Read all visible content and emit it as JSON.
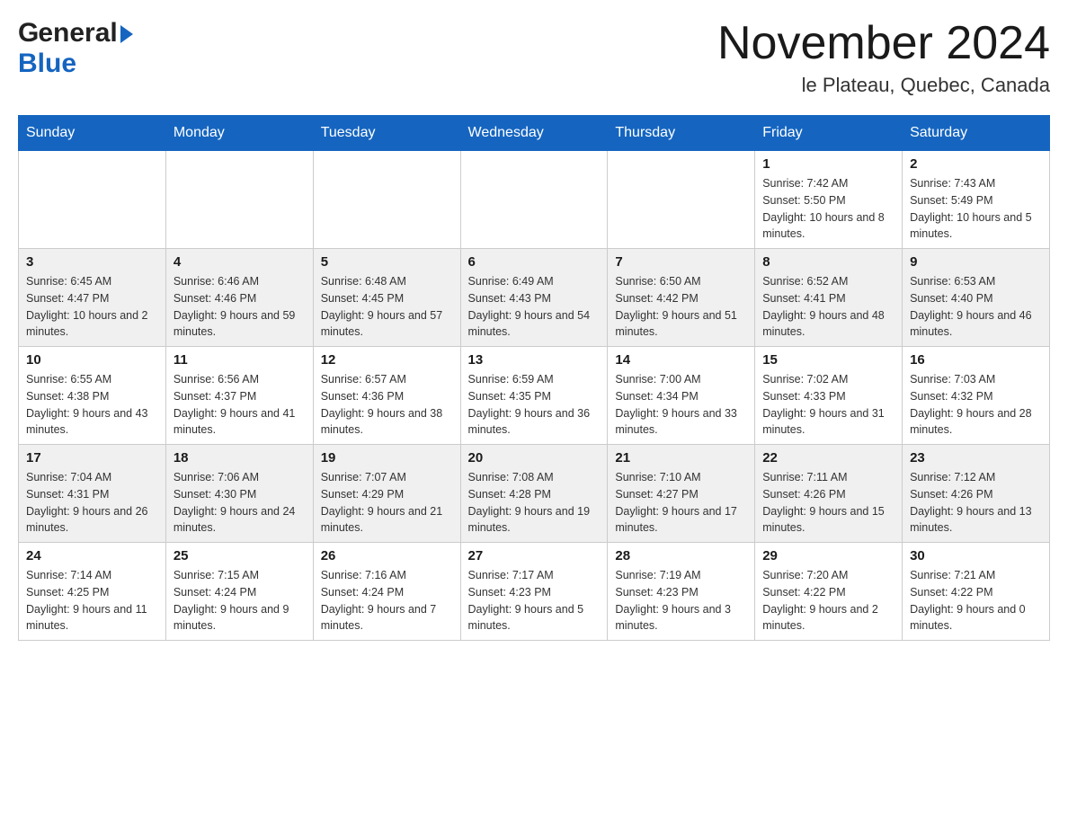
{
  "header": {
    "month_title": "November 2024",
    "location": "le Plateau, Quebec, Canada",
    "logo_general": "General",
    "logo_blue": "Blue"
  },
  "days_of_week": [
    "Sunday",
    "Monday",
    "Tuesday",
    "Wednesday",
    "Thursday",
    "Friday",
    "Saturday"
  ],
  "weeks": [
    [
      {
        "day": "",
        "sunrise": "",
        "sunset": "",
        "daylight": ""
      },
      {
        "day": "",
        "sunrise": "",
        "sunset": "",
        "daylight": ""
      },
      {
        "day": "",
        "sunrise": "",
        "sunset": "",
        "daylight": ""
      },
      {
        "day": "",
        "sunrise": "",
        "sunset": "",
        "daylight": ""
      },
      {
        "day": "",
        "sunrise": "",
        "sunset": "",
        "daylight": ""
      },
      {
        "day": "1",
        "sunrise": "Sunrise: 7:42 AM",
        "sunset": "Sunset: 5:50 PM",
        "daylight": "Daylight: 10 hours and 8 minutes."
      },
      {
        "day": "2",
        "sunrise": "Sunrise: 7:43 AM",
        "sunset": "Sunset: 5:49 PM",
        "daylight": "Daylight: 10 hours and 5 minutes."
      }
    ],
    [
      {
        "day": "3",
        "sunrise": "Sunrise: 6:45 AM",
        "sunset": "Sunset: 4:47 PM",
        "daylight": "Daylight: 10 hours and 2 minutes."
      },
      {
        "day": "4",
        "sunrise": "Sunrise: 6:46 AM",
        "sunset": "Sunset: 4:46 PM",
        "daylight": "Daylight: 9 hours and 59 minutes."
      },
      {
        "day": "5",
        "sunrise": "Sunrise: 6:48 AM",
        "sunset": "Sunset: 4:45 PM",
        "daylight": "Daylight: 9 hours and 57 minutes."
      },
      {
        "day": "6",
        "sunrise": "Sunrise: 6:49 AM",
        "sunset": "Sunset: 4:43 PM",
        "daylight": "Daylight: 9 hours and 54 minutes."
      },
      {
        "day": "7",
        "sunrise": "Sunrise: 6:50 AM",
        "sunset": "Sunset: 4:42 PM",
        "daylight": "Daylight: 9 hours and 51 minutes."
      },
      {
        "day": "8",
        "sunrise": "Sunrise: 6:52 AM",
        "sunset": "Sunset: 4:41 PM",
        "daylight": "Daylight: 9 hours and 48 minutes."
      },
      {
        "day": "9",
        "sunrise": "Sunrise: 6:53 AM",
        "sunset": "Sunset: 4:40 PM",
        "daylight": "Daylight: 9 hours and 46 minutes."
      }
    ],
    [
      {
        "day": "10",
        "sunrise": "Sunrise: 6:55 AM",
        "sunset": "Sunset: 4:38 PM",
        "daylight": "Daylight: 9 hours and 43 minutes."
      },
      {
        "day": "11",
        "sunrise": "Sunrise: 6:56 AM",
        "sunset": "Sunset: 4:37 PM",
        "daylight": "Daylight: 9 hours and 41 minutes."
      },
      {
        "day": "12",
        "sunrise": "Sunrise: 6:57 AM",
        "sunset": "Sunset: 4:36 PM",
        "daylight": "Daylight: 9 hours and 38 minutes."
      },
      {
        "day": "13",
        "sunrise": "Sunrise: 6:59 AM",
        "sunset": "Sunset: 4:35 PM",
        "daylight": "Daylight: 9 hours and 36 minutes."
      },
      {
        "day": "14",
        "sunrise": "Sunrise: 7:00 AM",
        "sunset": "Sunset: 4:34 PM",
        "daylight": "Daylight: 9 hours and 33 minutes."
      },
      {
        "day": "15",
        "sunrise": "Sunrise: 7:02 AM",
        "sunset": "Sunset: 4:33 PM",
        "daylight": "Daylight: 9 hours and 31 minutes."
      },
      {
        "day": "16",
        "sunrise": "Sunrise: 7:03 AM",
        "sunset": "Sunset: 4:32 PM",
        "daylight": "Daylight: 9 hours and 28 minutes."
      }
    ],
    [
      {
        "day": "17",
        "sunrise": "Sunrise: 7:04 AM",
        "sunset": "Sunset: 4:31 PM",
        "daylight": "Daylight: 9 hours and 26 minutes."
      },
      {
        "day": "18",
        "sunrise": "Sunrise: 7:06 AM",
        "sunset": "Sunset: 4:30 PM",
        "daylight": "Daylight: 9 hours and 24 minutes."
      },
      {
        "day": "19",
        "sunrise": "Sunrise: 7:07 AM",
        "sunset": "Sunset: 4:29 PM",
        "daylight": "Daylight: 9 hours and 21 minutes."
      },
      {
        "day": "20",
        "sunrise": "Sunrise: 7:08 AM",
        "sunset": "Sunset: 4:28 PM",
        "daylight": "Daylight: 9 hours and 19 minutes."
      },
      {
        "day": "21",
        "sunrise": "Sunrise: 7:10 AM",
        "sunset": "Sunset: 4:27 PM",
        "daylight": "Daylight: 9 hours and 17 minutes."
      },
      {
        "day": "22",
        "sunrise": "Sunrise: 7:11 AM",
        "sunset": "Sunset: 4:26 PM",
        "daylight": "Daylight: 9 hours and 15 minutes."
      },
      {
        "day": "23",
        "sunrise": "Sunrise: 7:12 AM",
        "sunset": "Sunset: 4:26 PM",
        "daylight": "Daylight: 9 hours and 13 minutes."
      }
    ],
    [
      {
        "day": "24",
        "sunrise": "Sunrise: 7:14 AM",
        "sunset": "Sunset: 4:25 PM",
        "daylight": "Daylight: 9 hours and 11 minutes."
      },
      {
        "day": "25",
        "sunrise": "Sunrise: 7:15 AM",
        "sunset": "Sunset: 4:24 PM",
        "daylight": "Daylight: 9 hours and 9 minutes."
      },
      {
        "day": "26",
        "sunrise": "Sunrise: 7:16 AM",
        "sunset": "Sunset: 4:24 PM",
        "daylight": "Daylight: 9 hours and 7 minutes."
      },
      {
        "day": "27",
        "sunrise": "Sunrise: 7:17 AM",
        "sunset": "Sunset: 4:23 PM",
        "daylight": "Daylight: 9 hours and 5 minutes."
      },
      {
        "day": "28",
        "sunrise": "Sunrise: 7:19 AM",
        "sunset": "Sunset: 4:23 PM",
        "daylight": "Daylight: 9 hours and 3 minutes."
      },
      {
        "day": "29",
        "sunrise": "Sunrise: 7:20 AM",
        "sunset": "Sunset: 4:22 PM",
        "daylight": "Daylight: 9 hours and 2 minutes."
      },
      {
        "day": "30",
        "sunrise": "Sunrise: 7:21 AM",
        "sunset": "Sunset: 4:22 PM",
        "daylight": "Daylight: 9 hours and 0 minutes."
      }
    ]
  ]
}
